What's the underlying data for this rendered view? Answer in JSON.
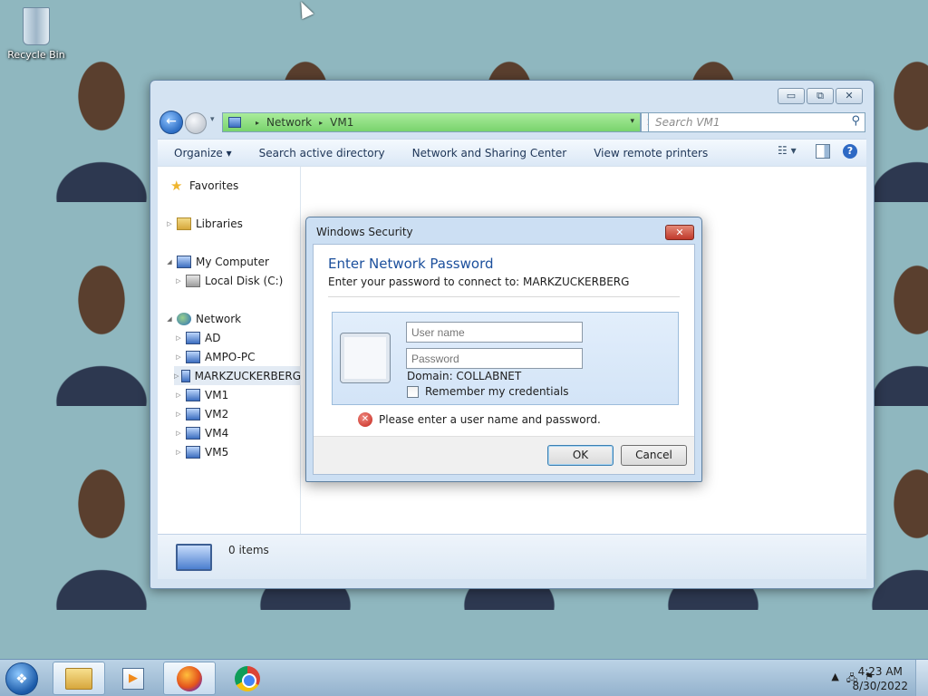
{
  "desktop": {
    "recycle_bin_label": "Recycle Bin"
  },
  "explorer": {
    "caption": {
      "minimize": "▭",
      "restore": "⧉",
      "close": "✕"
    },
    "nav": {
      "back": "←",
      "dropdown": "▾"
    },
    "address": {
      "root": "Network",
      "current": "VM1",
      "sep": "▸",
      "dropdown": "▾",
      "stop": "✕"
    },
    "search": {
      "placeholder": "Search VM1",
      "icon": "⚲"
    },
    "toolbar": {
      "organize": "Organize ▾",
      "search_ad": "Search active directory",
      "network_sharing": "Network and Sharing Center",
      "remote_printers": "View remote printers",
      "views": "☷ ▾",
      "help": "?"
    },
    "nav_pane": {
      "favorites": "Favorites",
      "libraries": "Libraries",
      "my_computer": "My Computer",
      "local_disk": "Local Disk (C:)",
      "network": "Network",
      "computers": [
        "AD",
        "AMPO-PC",
        "MARKZUCKERBERG",
        "VM1",
        "VM2",
        "VM4",
        "VM5"
      ],
      "expanded_arrow": "◢",
      "collapsed_arrow": "▷"
    },
    "details": {
      "items": "0 items"
    }
  },
  "dialog": {
    "title": "Windows Security",
    "close": "✕",
    "heading": "Enter Network Password",
    "subtitle": "Enter your password to connect to: MARKZUCKERBERG",
    "username_placeholder": "User name",
    "password_placeholder": "Password",
    "domain": "Domain: COLLABNET",
    "remember": "Remember my credentials",
    "error_icon": "✕",
    "error": "Please enter a user name and password.",
    "ok": "OK",
    "cancel": "Cancel"
  },
  "taskbar": {
    "start": "❖",
    "media": "▶",
    "tray": {
      "chevron": "▲",
      "network": "🖧",
      "flag": "⚑"
    },
    "time": "4:23 AM",
    "date": "8/30/2022"
  }
}
